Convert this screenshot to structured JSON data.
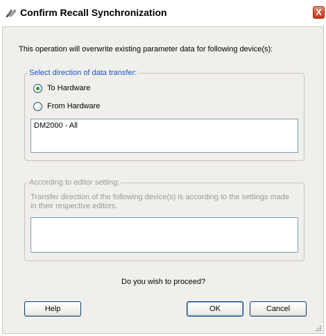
{
  "window": {
    "title": "Confirm Recall Synchronization",
    "close_label": "X"
  },
  "message": "This operation will overwrite existing parameter data for following device(s):",
  "direction_group": {
    "legend": "Select direction of data transfer:",
    "options": [
      {
        "label": "To Hardware",
        "selected": true
      },
      {
        "label": "From Hardware",
        "selected": false
      }
    ],
    "devices": [
      "DM2000 - All"
    ]
  },
  "editor_group": {
    "legend": "According to editor setting:",
    "description_line1": "Transfer direction of the following device(s) is according to the settings made",
    "description_line2": "in their respective editors.",
    "devices": []
  },
  "prompt": "Do you wish to proceed?",
  "buttons": {
    "help": "Help",
    "ok": "OK",
    "cancel": "Cancel"
  },
  "colors": {
    "legend_active": "#1c4fc4",
    "legend_disabled": "#9c9a94",
    "radio_dot": "#21a121"
  }
}
